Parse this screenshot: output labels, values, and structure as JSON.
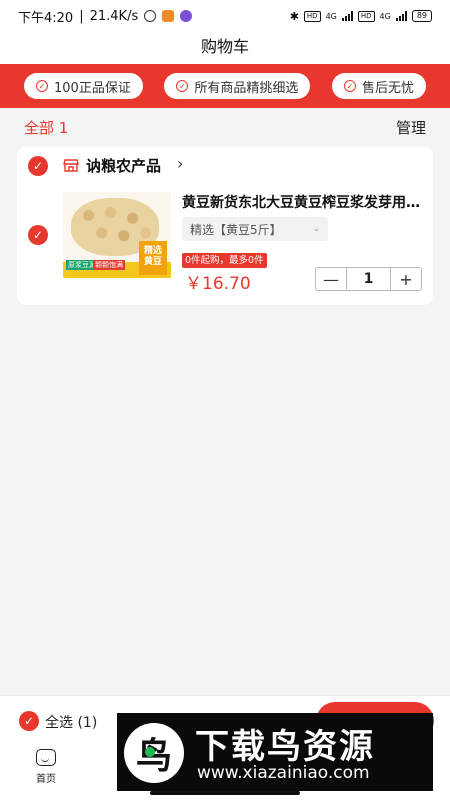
{
  "status_bar": {
    "time": "下午4:20",
    "net_speed": "21.4K/s",
    "signal_1": "4G",
    "signal_2": "4G",
    "hd_1": "HD",
    "hd_2": "HD",
    "battery": "89"
  },
  "header": {
    "title": "购物车"
  },
  "guarantees": [
    {
      "label": "100正品保证",
      "icon": "check-circle-icon"
    },
    {
      "label": "所有商品精挑细选",
      "icon": "check-circle-icon"
    },
    {
      "label": "售后无忧",
      "icon": "check-circle-icon"
    }
  ],
  "cart_summary": {
    "all_label": "全部 1",
    "manage_label": "管理"
  },
  "store": {
    "name": "讷粮农产品",
    "arrow": "›",
    "items": [
      {
        "title": "黄豆新货东北大豆黄豆榨豆浆发芽用打豆浆",
        "variant": "精选【黄豆5斤】",
        "limit": "0件起购，最多0件",
        "price": "￥16.70",
        "quantity": "1",
        "minus": "—",
        "plus": "+",
        "image_tag": "精选 黄豆",
        "image_label_1": "原浆豆源",
        "image_label_2": "颗颗饱满"
      }
    ]
  },
  "checkout": {
    "select_all_label": "全选 (1)"
  },
  "tabbar": {
    "home_label": "首页"
  },
  "watermark": {
    "logo": "鸟",
    "title": "下载鸟资源",
    "url": "www.xiazainiao.com"
  },
  "colors": {
    "accent": "#e8382e"
  }
}
